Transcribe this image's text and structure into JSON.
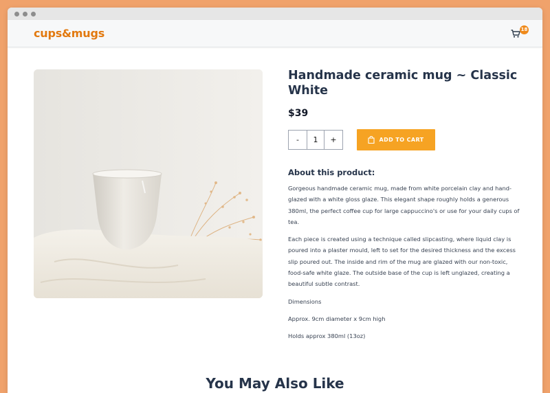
{
  "header": {
    "logo": "cups&mugs",
    "cart_count": "18"
  },
  "product": {
    "title": "Handmade ceramic mug ~ Classic White",
    "price": "$39",
    "quantity": "1",
    "decrement_label": "-",
    "increment_label": "+",
    "add_to_cart_label": "ADD TO CART",
    "about_heading": "About this product:",
    "paragraphs": [
      "Gorgeous handmade ceramic mug, made from white porcelain clay and hand-glazed with a white gloss glaze. This elegant shape roughly holds a generous 380ml, the perfect coffee cup for large cappuccino's or use for your daily cups of tea.",
      "Each piece is created using a technique called slipcasting, where liquid clay is poured into a plaster mould, left to set for the desired thickness and the excess slip poured out. The inside and rim of the mug are glazed with our non-toxic, food-safe white glaze. The outside base of the cup is left unglazed, creating a beautiful subtle contrast.",
      "Dimensions",
      "Approx. 9cm diameter x 9cm high",
      "Holds approx 380ml (13oz)"
    ]
  },
  "related": {
    "heading": "You May Also Like"
  },
  "colors": {
    "brand": "#e2790f",
    "button": "#f6a323",
    "background": "#f0a26b"
  }
}
